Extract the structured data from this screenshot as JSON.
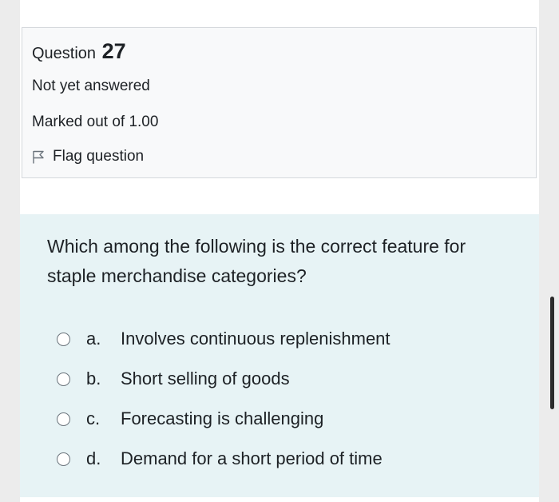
{
  "question": {
    "label": "Question",
    "number": "27",
    "state": "Not yet answered",
    "grade": "Marked out of 1.00",
    "flag_label": "Flag question",
    "flag_icon": "flag-icon"
  },
  "formulation": {
    "text": "Which among the following is the correct feature for staple merchandise categories?",
    "answers": [
      {
        "letter": "a.",
        "text": "Involves continuous replenishment",
        "selected": false
      },
      {
        "letter": "b.",
        "text": "Short selling of goods",
        "selected": false
      },
      {
        "letter": "c.",
        "text": "Forecasting is challenging",
        "selected": false
      },
      {
        "letter": "d.",
        "text": "Demand for a short period of time",
        "selected": false
      }
    ]
  },
  "colors": {
    "page_background": "#ececec",
    "info_background": "#f8f9fa",
    "formulation_background": "#e7f3f5",
    "text": "#1d2125"
  }
}
